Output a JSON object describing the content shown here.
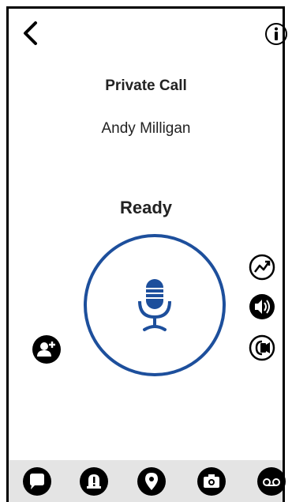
{
  "header": {
    "back_icon": "chevron-left-icon",
    "info_icon": "info-icon"
  },
  "call": {
    "type": "Private Call",
    "callee": "Andy Milligan",
    "status": "Ready"
  },
  "ptt": {
    "icon": "microphone-icon",
    "accent_color": "#1d4f9c"
  },
  "side_controls": [
    {
      "name": "signal-quality-icon"
    },
    {
      "name": "speaker-icon"
    },
    {
      "name": "earpiece-icon"
    }
  ],
  "add_user": {
    "icon": "add-user-icon"
  },
  "bottom_nav": [
    {
      "icon": "chat-bubble-icon"
    },
    {
      "icon": "alert-bell-icon"
    },
    {
      "icon": "location-pin-icon"
    },
    {
      "icon": "camera-icon"
    },
    {
      "icon": "voicemail-icon"
    }
  ]
}
